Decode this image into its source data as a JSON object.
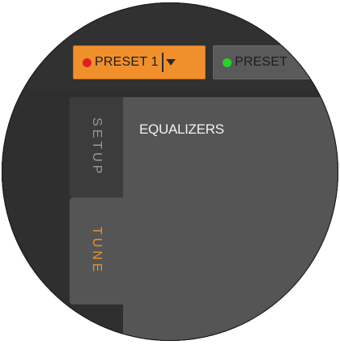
{
  "toolbar": {
    "presets": [
      {
        "label": "PRESET 1",
        "status": "red",
        "active": true,
        "has_dropdown": true
      },
      {
        "label": "PRESET",
        "status": "green",
        "active": false
      }
    ]
  },
  "sidebar": {
    "tabs": [
      {
        "label": "SETUP",
        "selected": false
      },
      {
        "label": "TUNE",
        "selected": true
      }
    ]
  },
  "panel": {
    "title": "EQUALIZERS"
  },
  "colors": {
    "accent": "#f0902c",
    "status_red": "#e02020",
    "status_green": "#26d426",
    "background": "#2f2f2f",
    "panel": "#555555"
  }
}
